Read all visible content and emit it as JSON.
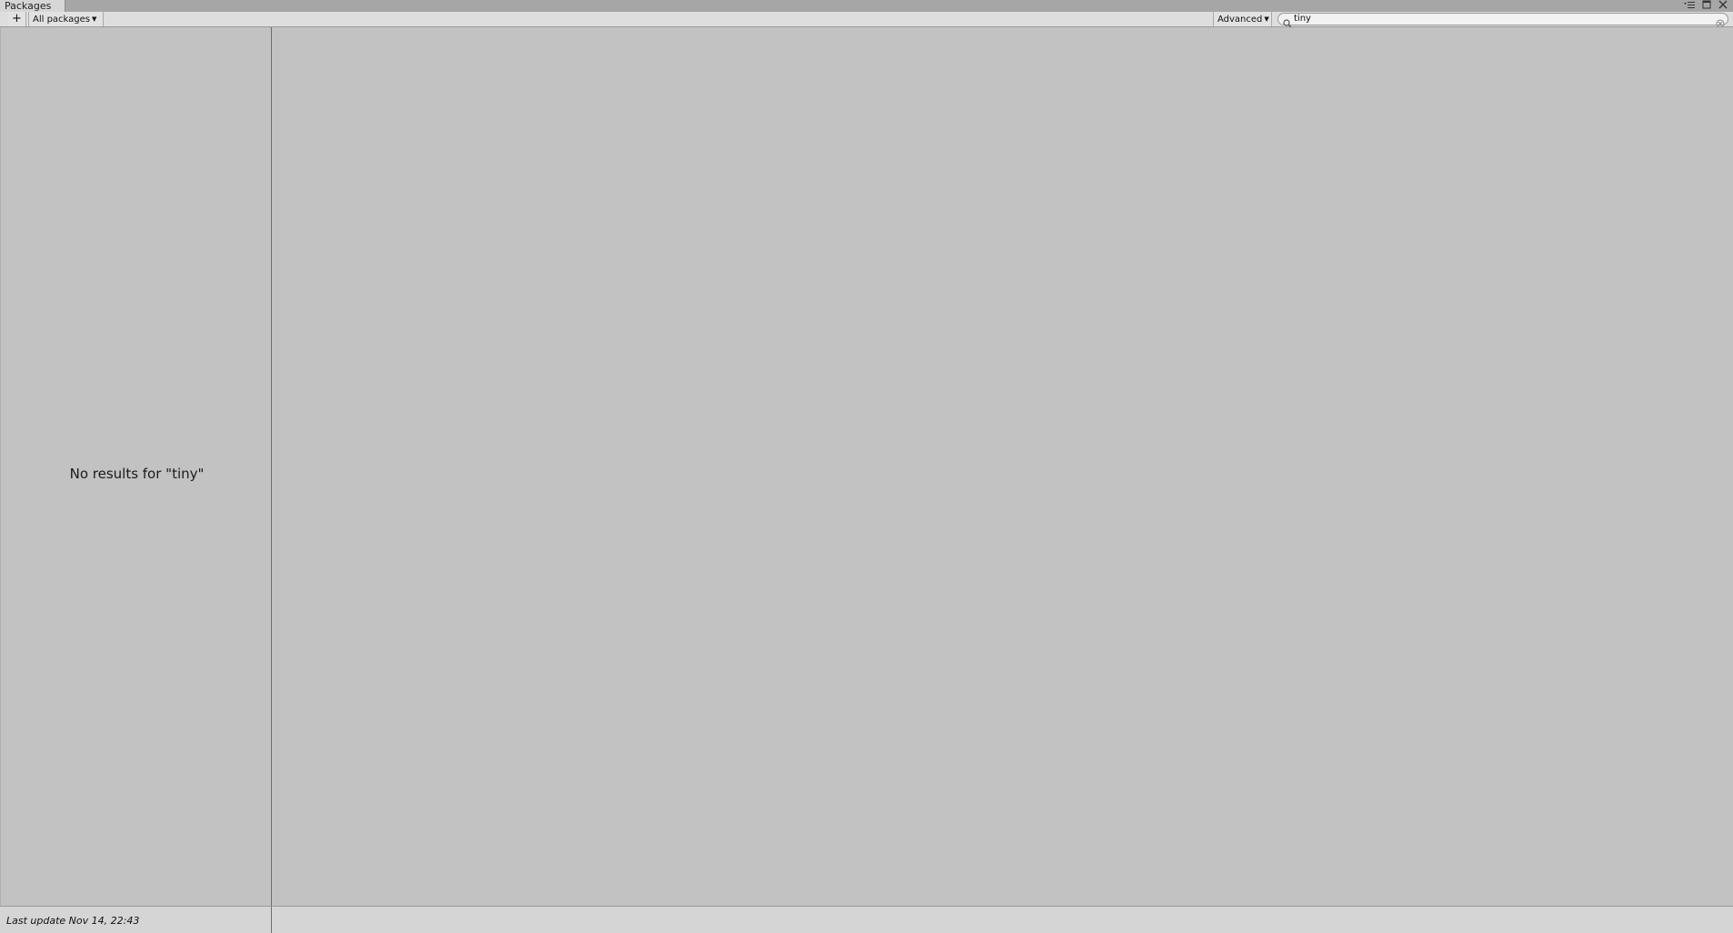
{
  "window": {
    "tab_title": "Packages",
    "controls": {
      "menu_icon": "menu-icon",
      "maximize_icon": "maximize-icon",
      "close_icon": "close-icon"
    }
  },
  "toolbar": {
    "add_label": "+",
    "filter_label": "All packages",
    "advanced_label": "Advanced"
  },
  "search": {
    "value": "tiny",
    "icon": "search-icon",
    "clear_icon": "clear-icon"
  },
  "package_list": {
    "empty_message": "No results for \"tiny\""
  },
  "status": {
    "last_update": "Last update Nov 14, 22:43"
  }
}
